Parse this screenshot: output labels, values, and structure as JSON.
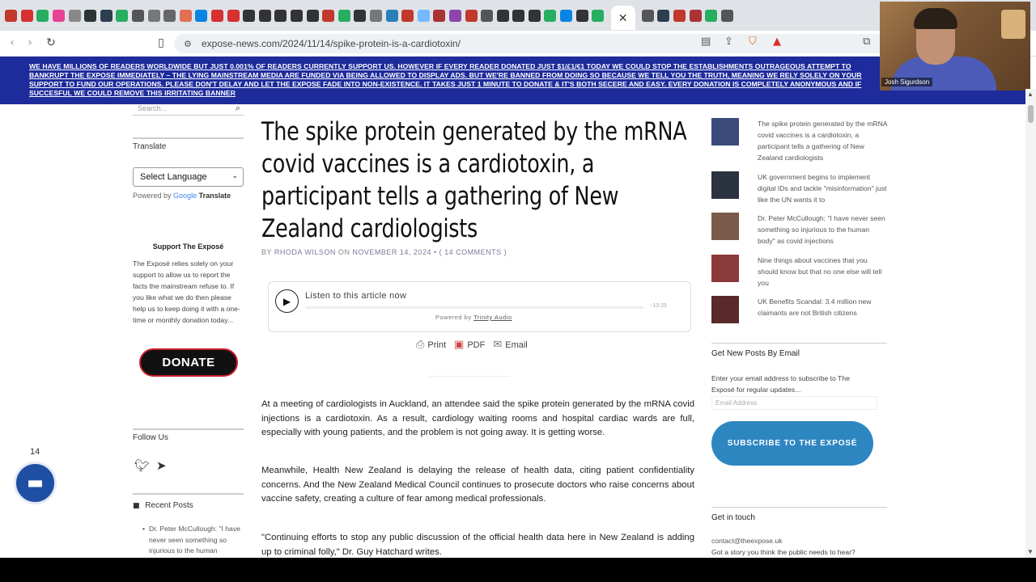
{
  "browser": {
    "favicon_colors": [
      "#c0392b",
      "#d63031",
      "#27ae60",
      "#e84393",
      "#888888",
      "#2d3436",
      "#2c3e50",
      "#27ae60",
      "#555555",
      "#777777",
      "#666666",
      "#e17055",
      "#0984e3",
      "#d63031",
      "#d63031",
      "#333333",
      "#333333",
      "#333333",
      "#333333",
      "#333333",
      "#c0392b",
      "#27ae60",
      "#333333",
      "#777777",
      "#2980b9",
      "#c0392b",
      "#74b9ff",
      "#a33",
      "#8e44ad",
      "#c0392b",
      "#555555",
      "#333333",
      "#333333",
      "#333333",
      "#27ae60",
      "#0984e3",
      "#333333",
      "#27ae60",
      "#555555",
      "#2c3e50",
      "#c0392b",
      "#a33",
      "#27ae60",
      "#555555"
    ],
    "url": "expose-news.com/2024/11/14/spike-protein-is-a-cardiotoxin/",
    "close_glyph": "✕"
  },
  "banner": {
    "text": "We have millions of readers worldwide but just 0.001% of readers currently support us. However if every reader donated just $1/£1/€1 today we could stop the establishments outrageous attempt to bankrupt The Expose immediately – The lying mainstream media are funded via being allowed to display ads. But we're banned from doing so because we tell you the truth, meaning we rely solely on your support to fund our operations. Please don't delay and let The Expose fade into non-existence. It takes just 1 minute to donate & it's both secere and easy. Every donation is completely anonymous and if succesful we could remove this irritating banner"
  },
  "webcam": {
    "name": "Josh Sigurdson"
  },
  "left": {
    "search_placeholder": "Search...",
    "translate_head": "Translate",
    "language_select": "Select Language",
    "powered_by": "Powered by",
    "google": "Google",
    "translate_word": "Translate",
    "support_title": "Support The Exposé",
    "support_text": "The Exposé relies solely on your support to allow us to report the facts the mainstream refuse to. If you like what we do then please help us to keep doing it with a one-time or monthly donation today...",
    "donate_label": "DONATE",
    "follow_head": "Follow Us",
    "recent_head": "Recent Posts",
    "recent_items": [
      "Dr. Peter McCullough: \"I have never seen something so injurious to the human"
    ]
  },
  "chat": {
    "count": "14"
  },
  "article": {
    "title": "The spike protein generated by the mRNA covid vaccines is a cardiotoxin, a participant tells a gathering of New Zealand cardiologists",
    "by": "BY",
    "author": "RHODA WILSON",
    "on": "ON",
    "date": "NOVEMBER 14, 2024",
    "bullet": "•",
    "comments": "( 14 COMMENTS )",
    "audio_label": "Listen to this article now",
    "audio_time": "-10:35",
    "audio_powered": "Powered by",
    "audio_vendor": "Trinity Audio",
    "print": "Print",
    "pdf": "PDF",
    "email": "Email",
    "paragraphs": [
      "At a meeting of cardiologists in Auckland, an attendee said the spike protein generated by the mRNA covid injections is a cardiotoxin. As a result, cardiology waiting rooms and hospital cardiac wards are full, especially with young patients, and the problem is not going away. It is getting worse.",
      "Meanwhile, Health New Zealand is delaying the release of health data, citing patient confidentiality concerns.  And the New Zealand Medical Council continues to prosecute doctors who raise concerns about vaccine safety, creating a culture of fear among medical professionals.",
      "\"Continuing efforts to stop any public discussion of the official health data here in New Zealand is adding up to criminal folly,\" Dr. Guy Hatchard writes."
    ]
  },
  "right": {
    "posts": [
      {
        "text": "The spike protein generated by the mRNA covid vaccines is a cardiotoxin, a participant tells a gathering of New Zealand cardiologists",
        "color": "#3a4a7a"
      },
      {
        "text": "UK government begins to implement digital IDs and tackle \"misinformation\" just like the UN wants it to",
        "color": "#2b3340"
      },
      {
        "text": "Dr. Peter McCullough: \"I have never seen something so injurious to the human body\" as covid injections",
        "color": "#7a5a48"
      },
      {
        "text": "Nine things about vaccines that you should know but that no one else will tell you",
        "color": "#8a3a3a"
      },
      {
        "text": "UK Benefits Scandal: 3.4 million new claimants are not British citizens",
        "color": "#5a2a2a"
      }
    ],
    "email_head": "Get New Posts By Email",
    "email_desc": "Enter your email address to subscribe to The Exposé for regular updates...",
    "email_placeholder": "Email Address",
    "subscribe_label": "SUBSCRIBE TO THE EXPOSÉ",
    "touch_head": "Get in touch",
    "touch_email": "contact@theexpose.uk",
    "touch_question": "Got a story you think the public needs to hear?"
  }
}
